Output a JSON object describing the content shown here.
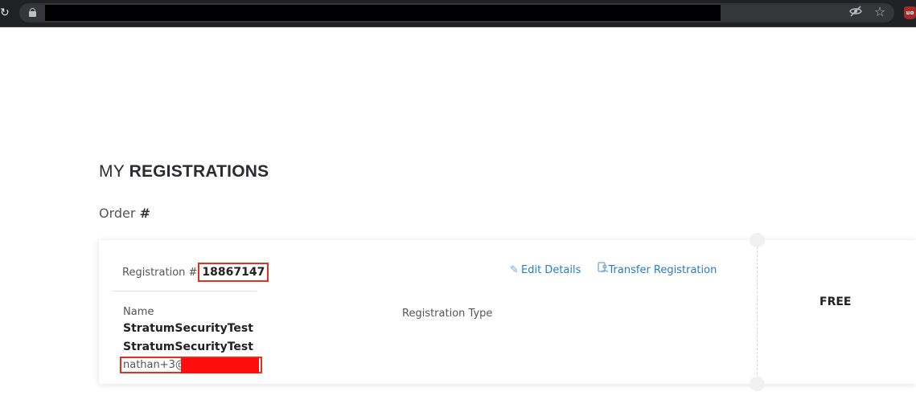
{
  "browser": {
    "reload_icon": "reload-icon",
    "lock_icon": "lock-icon",
    "eye_off_icon": "eye-off-icon",
    "star_icon": "star-icon",
    "extension_label": "uo"
  },
  "page": {
    "title_light": "MY",
    "title_bold": "REGISTRATIONS",
    "order_label": "Order",
    "order_hash": "#"
  },
  "registration": {
    "label": "Registration #",
    "number": "18867147",
    "actions": [
      {
        "label": "Edit Details",
        "icon": "pencil-icon"
      },
      {
        "label": "Transfer Registration",
        "icon": "transfer-user-icon"
      }
    ],
    "name_label": "Name",
    "first_name": "StratumSecurityTest",
    "last_name": "StratumSecurityTest",
    "email_prefix": "nathan+3@",
    "type_label": "Registration Type",
    "price": "FREE"
  },
  "colors": {
    "accent_link": "#2a7cc0",
    "highlight_red": "#e53020",
    "redaction_red": "#ff0d0d"
  }
}
